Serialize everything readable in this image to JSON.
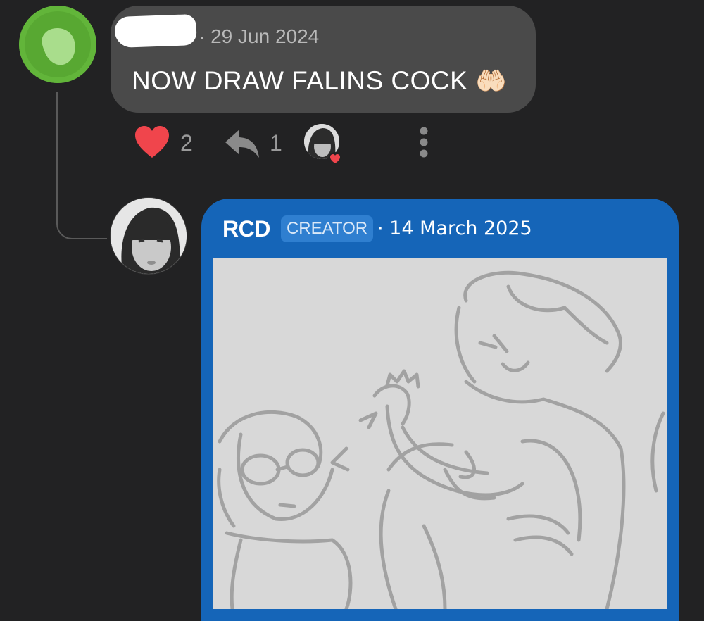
{
  "comment": {
    "date": "· 29 Jun 2024",
    "text": "NOW DRAW FALINS COCK",
    "emoji": "🤲🏻",
    "likes": "2",
    "replies": "1",
    "icons": {
      "like": "heart-icon",
      "reply": "reply-icon",
      "more": "more-vertical-icon"
    }
  },
  "reply": {
    "author": "RCD",
    "badge": "CREATOR",
    "date": "· 14 March 2025"
  },
  "colors": {
    "background": "#222223",
    "bubble": "#4a4a4a",
    "card": "#1565b8",
    "badge": "#2f7fd0",
    "heart": "#f0454c",
    "avatar_green": "#62b53a"
  }
}
